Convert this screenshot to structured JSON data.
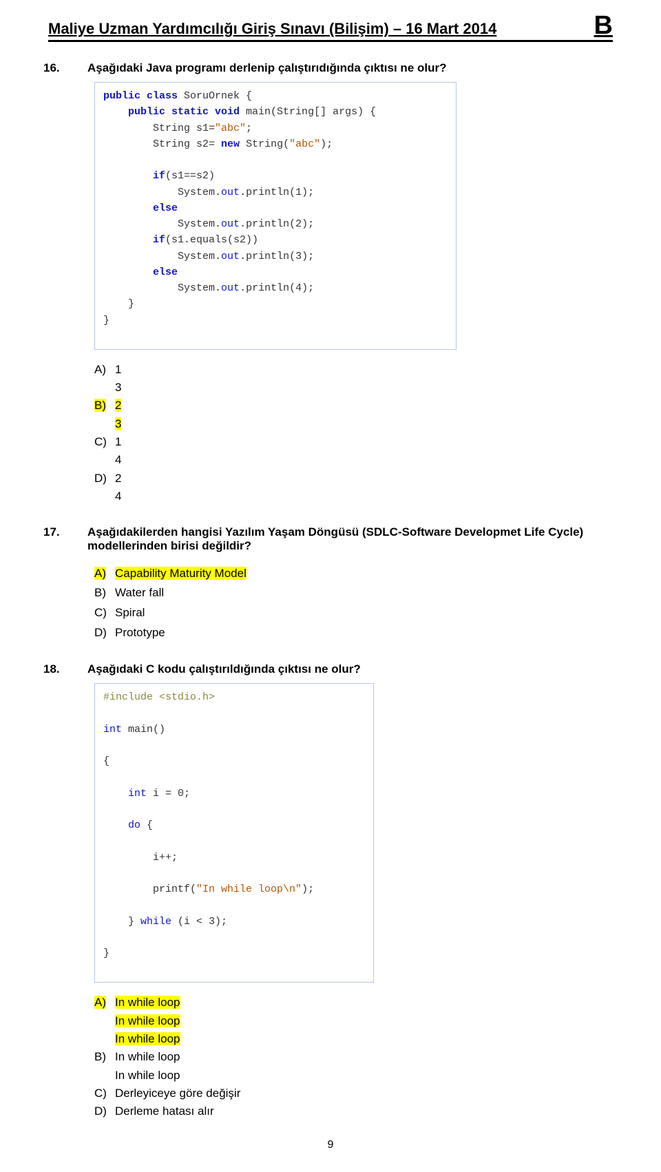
{
  "header": {
    "title": "Maliye Uzman Yardımcılığı Giriş Sınavı (Bilişim) – 16 Mart 2014",
    "badge": "B"
  },
  "q16": {
    "num": "16.",
    "text": "Aşağıdaki Java programı derlenip çalıştırıdığında çıktısı ne olur?",
    "code": {
      "l1a": "public class",
      "l1b": " SoruOrnek {",
      "l2a": "public static void",
      "l2b": " main(String[] args) {",
      "l3": "String s1=",
      "l3s": "\"abc\"",
      "l3e": ";",
      "l4a": "String s2= ",
      "l4kw": "new",
      "l4b": " String(",
      "l4s": "\"abc\"",
      "l4e": ");",
      "l5kw": "if",
      "l5b": "(s1==s2)",
      "l6a": "System.",
      "l6o": "out",
      "l6b": ".println(1);",
      "l7": "else",
      "l8a": "System.",
      "l8o": "out",
      "l8b": ".println(2);",
      "l9kw": "if",
      "l9b": "(s1.equals(s2))",
      "l10a": "System.",
      "l10o": "out",
      "l10b": ".println(3);",
      "l11": "else",
      "l12a": "System.",
      "l12o": "out",
      "l12b": ".println(4);",
      "l13": "}",
      "l14": "}"
    },
    "optA_letter": "A)",
    "optA1": "1",
    "optA2": "3",
    "optB_letter": "B)",
    "optB1": "2",
    "optB2": "3",
    "optC_letter": "C)",
    "optC1": "1",
    "optC2": "4",
    "optD_letter": "D)",
    "optD1": "2",
    "optD2": "4"
  },
  "q17": {
    "num": "17.",
    "text": "Aşağıdakilerden hangisi Yazılım Yaşam Döngüsü (SDLC-Software Developmet Life Cycle) modellerinden birisi değildir?",
    "optA_letter": "A)",
    "optA": "Capability Maturity Model",
    "optB_letter": "B)",
    "optB": "Water fall",
    "optC_letter": "C)",
    "optC": "Spiral",
    "optD_letter": "D)",
    "optD": "Prototype"
  },
  "q18": {
    "num": "18.",
    "text": "Aşağıdaki C kodu çalıştırıldığında çıktısı ne olur?",
    "code": {
      "l1": "#include <stdio.h>",
      "l2a": "int",
      "l2b": " main()",
      "l3": "{",
      "l4a": "int",
      "l4b": " i = 0;",
      "l5a": "do",
      "l5b": " {",
      "l6": "i++;",
      "l7a": "printf(",
      "l7s": "\"In while loop\\n\"",
      "l7b": ");",
      "l8a": "} ",
      "l8kw": "while",
      "l8b": " (i < 3);",
      "l9": "}"
    },
    "optA_letter": "A)",
    "optA1": "In while loop",
    "optA2": "In while loop",
    "optA3": "In while loop",
    "optB_letter": "B)",
    "optB1": "In while loop",
    "optB2": "In while loop",
    "optC_letter": "C)",
    "optC": "Derleyiceye göre değişir",
    "optD_letter": "D)",
    "optD": "Derleme hatası alır"
  },
  "pagenum": "9"
}
